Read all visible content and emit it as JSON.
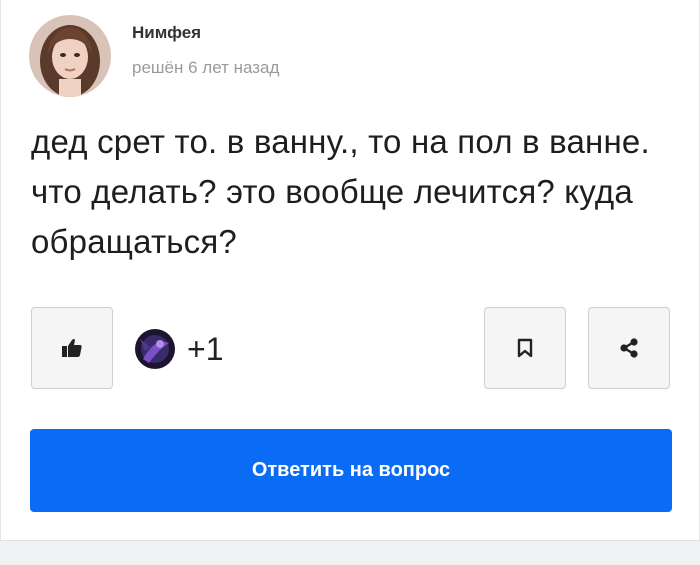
{
  "author": {
    "name": "Нимфея",
    "meta": "решён 6 лет назад"
  },
  "question": {
    "text": "дед срет то. в ванну., то на пол в ванне. что делать? это вообще лечится? куда обращаться?"
  },
  "actions": {
    "like_icon": "thumbs-up-icon",
    "likes_count": "+1",
    "bookmark_icon": "bookmark-icon",
    "share_icon": "share-icon"
  },
  "answer_button": {
    "label": "Ответить на вопрос"
  },
  "colors": {
    "accent": "#0a6cf5",
    "muted_text": "#9a9a9a",
    "button_bg": "#f5f5f6",
    "button_border": "#cfcfd3"
  }
}
